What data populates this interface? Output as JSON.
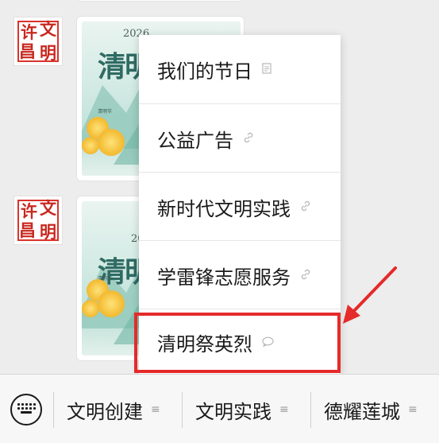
{
  "avatar": {
    "chars": [
      "许",
      "文",
      "昌",
      "明"
    ]
  },
  "posters": [
    {
      "year": "2026",
      "title": "清明",
      "footer": "..."
    },
    {
      "year": "2026",
      "title": "清明",
      "footer": "..."
    }
  ],
  "menu": {
    "items": [
      {
        "label": "我们的节日",
        "icon": "document-icon"
      },
      {
        "label": "公益广告",
        "icon": "link-icon"
      },
      {
        "label": "新时代文明实践",
        "icon": "link-icon"
      },
      {
        "label": "学雷锋志愿服务",
        "icon": "link-icon"
      },
      {
        "label": "清明祭英烈",
        "icon": "chat-bubble-icon"
      }
    ],
    "highlighted_index": 4
  },
  "bottom_bar": {
    "tabs": [
      {
        "label": "文明创建",
        "icon": "menu-lines-icon"
      },
      {
        "label": "文明实践",
        "icon": "menu-lines-icon"
      },
      {
        "label": "德耀莲城",
        "icon": "menu-lines-icon"
      }
    ]
  },
  "colors": {
    "highlight": "#e52a2a",
    "avatar_red": "#c8281f"
  }
}
